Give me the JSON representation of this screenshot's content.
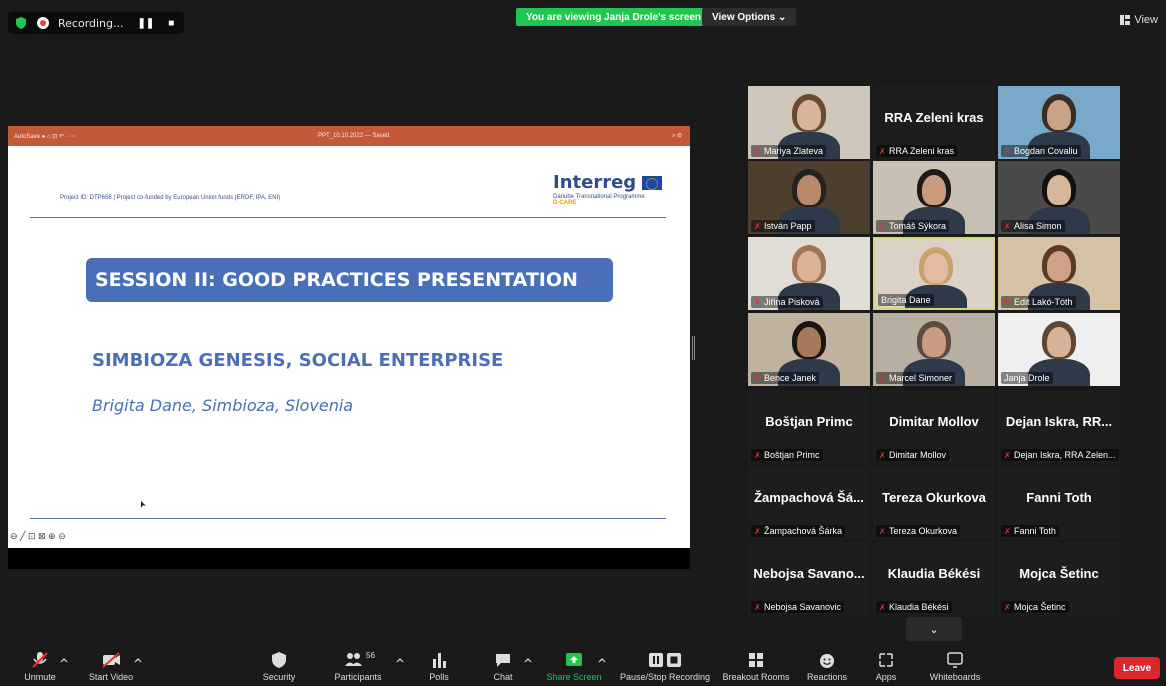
{
  "top": {
    "recording_label": "Recording...",
    "pause_label": "❚❚",
    "stop_label": "■",
    "viewing_banner": "You are viewing Janja Drole's screen",
    "view_options": "View Options ⌄",
    "view_label": "View"
  },
  "slide": {
    "ppt_left": "AutoSave ● ⌂ ⊡ ↶ ·  ⋯",
    "ppt_title": "PPT_10.10.2022 — Saved",
    "ppt_right": "⌕  ⚙",
    "project_id": "Project ID: DTP656 | Project co-funded by European Union funds (ERDF, IPA, ENI)",
    "interreg_name": "Interreg",
    "programme": "Danube Transnational Programme",
    "dcare": "D-CARE",
    "session_heading": "SESSION II: GOOD PRACTICES PRESENTATION",
    "main_title": "SIMBIOZA GENESIS, SOCIAL ENTERPRISE",
    "subtitle": "Brigita Dane, Simbioza, Slovenia",
    "tools": "⊖ ╱ ⊡ ⊠ ⊕ ⊝"
  },
  "gallery": {
    "tiles": [
      {
        "name": "Mariya Zlateva",
        "big": ""
      },
      {
        "name": "RRA Zeleni kras",
        "big": "RRA Zeleni kras"
      },
      {
        "name": "Bogdan Covaliu",
        "big": ""
      },
      {
        "name": "István Papp",
        "big": ""
      },
      {
        "name": "Tomáš Sýkora",
        "big": ""
      },
      {
        "name": "Alisa Simon",
        "big": ""
      },
      {
        "name": "Jiřina Pisková",
        "big": ""
      },
      {
        "name": "Brigita Dane",
        "big": ""
      },
      {
        "name": "Edit Lakó-Tóth",
        "big": ""
      },
      {
        "name": "Bence Janek",
        "big": ""
      },
      {
        "name": "Marcel Simoner",
        "big": ""
      },
      {
        "name": "Janja Drole",
        "big": ""
      },
      {
        "name": "Boštjan Primc",
        "big": "Boštjan Primc"
      },
      {
        "name": "Dimitar Mollov",
        "big": "Dimitar Mollov"
      },
      {
        "name": "Dejan Iskra, RRA Zelen...",
        "big": "Dejan Iskra, RR..."
      },
      {
        "name": "Žampachová Šárka",
        "big": "Žampachová Šá..."
      },
      {
        "name": "Tereza Okurkova",
        "big": "Tereza Okurkova"
      },
      {
        "name": "Fanni Toth",
        "big": "Fanni Toth"
      },
      {
        "name": "Nebojsa Savanovic",
        "big": "Nebojsa Savano..."
      },
      {
        "name": "Klaudia Békési",
        "big": "Klaudia Békési"
      },
      {
        "name": "Mojca Šetinc",
        "big": "Mojca Šetinc"
      }
    ],
    "expand_label": "⌄"
  },
  "toolbar": {
    "unmute": "Unmute",
    "start_video": "Start Video",
    "security": "Security",
    "participants": "Participants",
    "participant_count": "56",
    "polls": "Polls",
    "chat": "Chat",
    "share_screen": "Share Screen",
    "pause_recording": "Pause/Stop Recording",
    "breakout_rooms": "Breakout Rooms",
    "reactions": "Reactions",
    "apps": "Apps",
    "whiteboards": "Whiteboards",
    "leave": "Leave"
  },
  "colors": {
    "accent_green": "#23c552",
    "slide_blue": "#4a6fb8",
    "leave_red": "#d9262f",
    "ppt_orange": "#c4593a"
  }
}
